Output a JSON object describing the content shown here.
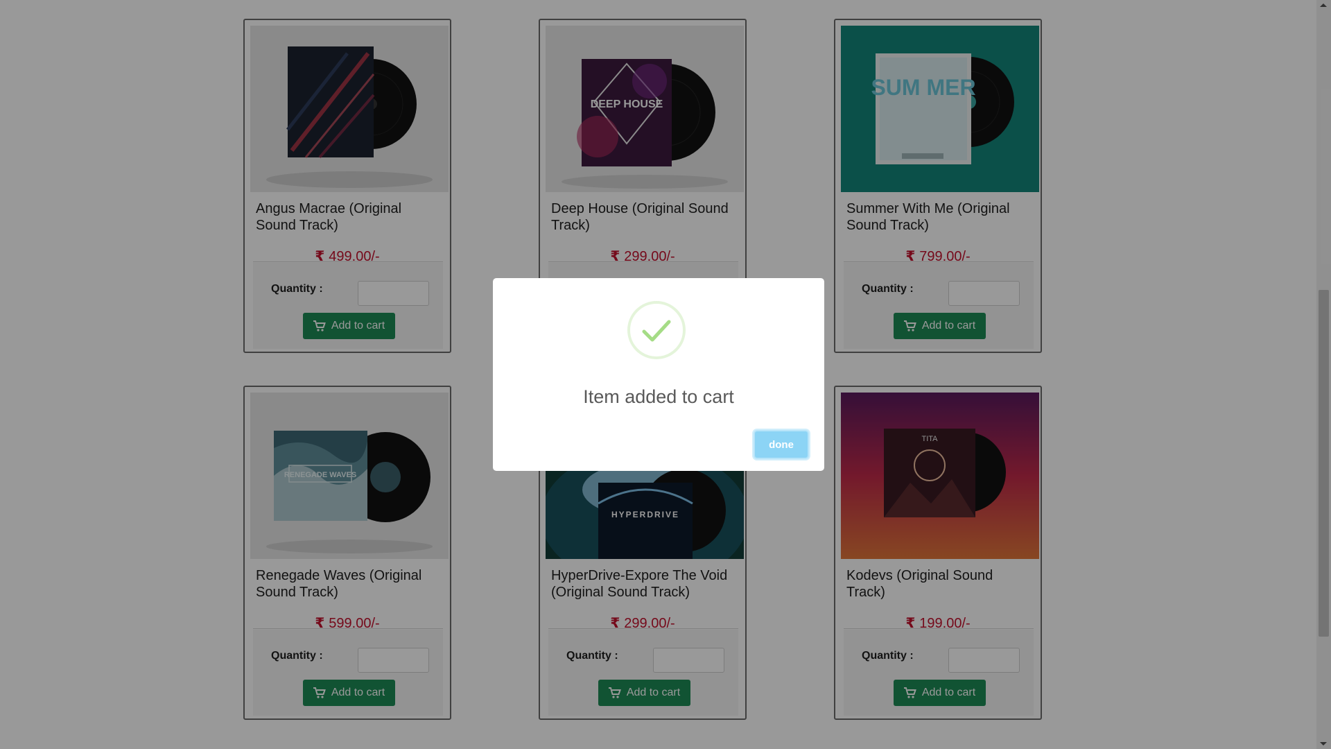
{
  "products": [
    {
      "title": "Angus Macrae (Original Sound Track)",
      "price": "499.00/-",
      "cover_text": ""
    },
    {
      "title": "Deep House (Original Sound Track)",
      "price": "299.00/-",
      "cover_text": "DEEP HOUSE"
    },
    {
      "title": "Summer With Me (Original Sound Track)",
      "price": "799.00/-",
      "cover_text": "SUM MER"
    },
    {
      "title": "Renegade Waves (Original Sound Track)",
      "price": "599.00/-",
      "cover_text": "RENEGADE WAVES"
    },
    {
      "title": "HyperDrive-Expore The Void (Original Sound Track)",
      "price": "299.00/-",
      "cover_text": "HYPERDRIVE"
    },
    {
      "title": "Kodevs (Original Sound Track)",
      "price": "199.00/-",
      "cover_text": "TITA"
    }
  ],
  "currency_symbol": "₹",
  "quantity_label": "Quantity :",
  "add_to_cart_label": "Add to cart",
  "modal": {
    "message": "Item added to cart",
    "done_label": "done",
    "icon": "success-check-icon"
  },
  "colors": {
    "price": "#c4112d",
    "add_button": "#1d8a55",
    "done_button": "#8cd4f5",
    "check": "#a5dc86"
  }
}
